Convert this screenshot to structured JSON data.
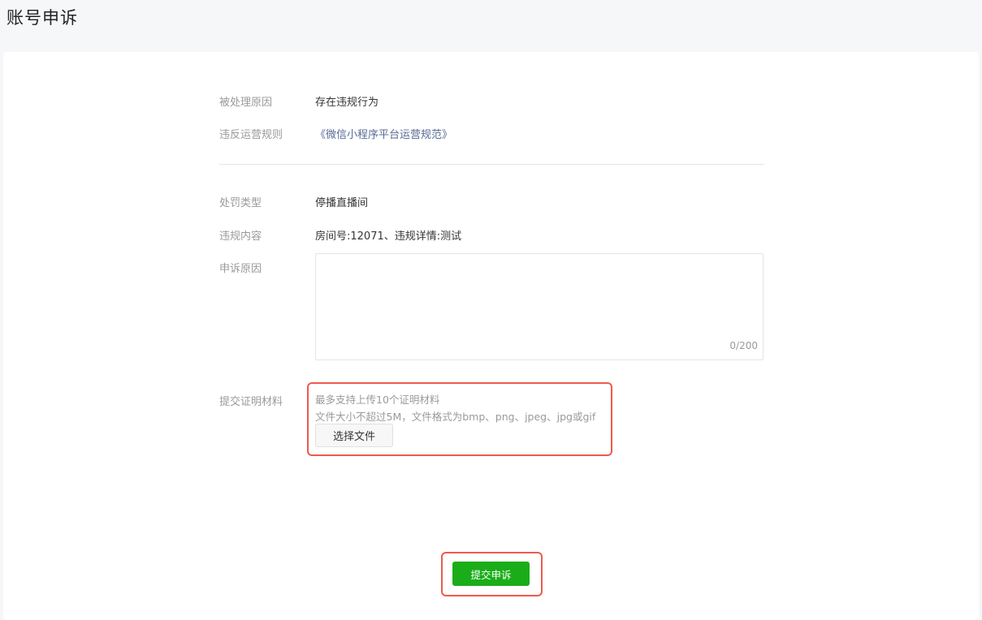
{
  "page": {
    "title": "账号申诉"
  },
  "violation": {
    "reason_label": "被处理原因",
    "reason_value": "存在违规行为",
    "rule_label": "违反运营规则",
    "rule_value": "《微信小程序平台运营规范》"
  },
  "penalty": {
    "type_label": "处罚类型",
    "type_value": "停播直播间",
    "content_label": "违规内容",
    "content_value": "房间号:12071、违规详情:测试"
  },
  "appeal": {
    "reason_label": "申诉原因",
    "reason_value": "",
    "counter": "0/200"
  },
  "evidence": {
    "label": "提交证明材料",
    "hint_line1": "最多支持上传10个证明材料",
    "hint_line2": "文件大小不超过5M，文件格式为bmp、png、jpeg、jpg或gif",
    "choose_button": "选择文件"
  },
  "actions": {
    "submit_button": "提交申诉"
  },
  "colors": {
    "link": "#576b95",
    "primary": "#1aad19",
    "highlight": "#ee5a4f"
  }
}
